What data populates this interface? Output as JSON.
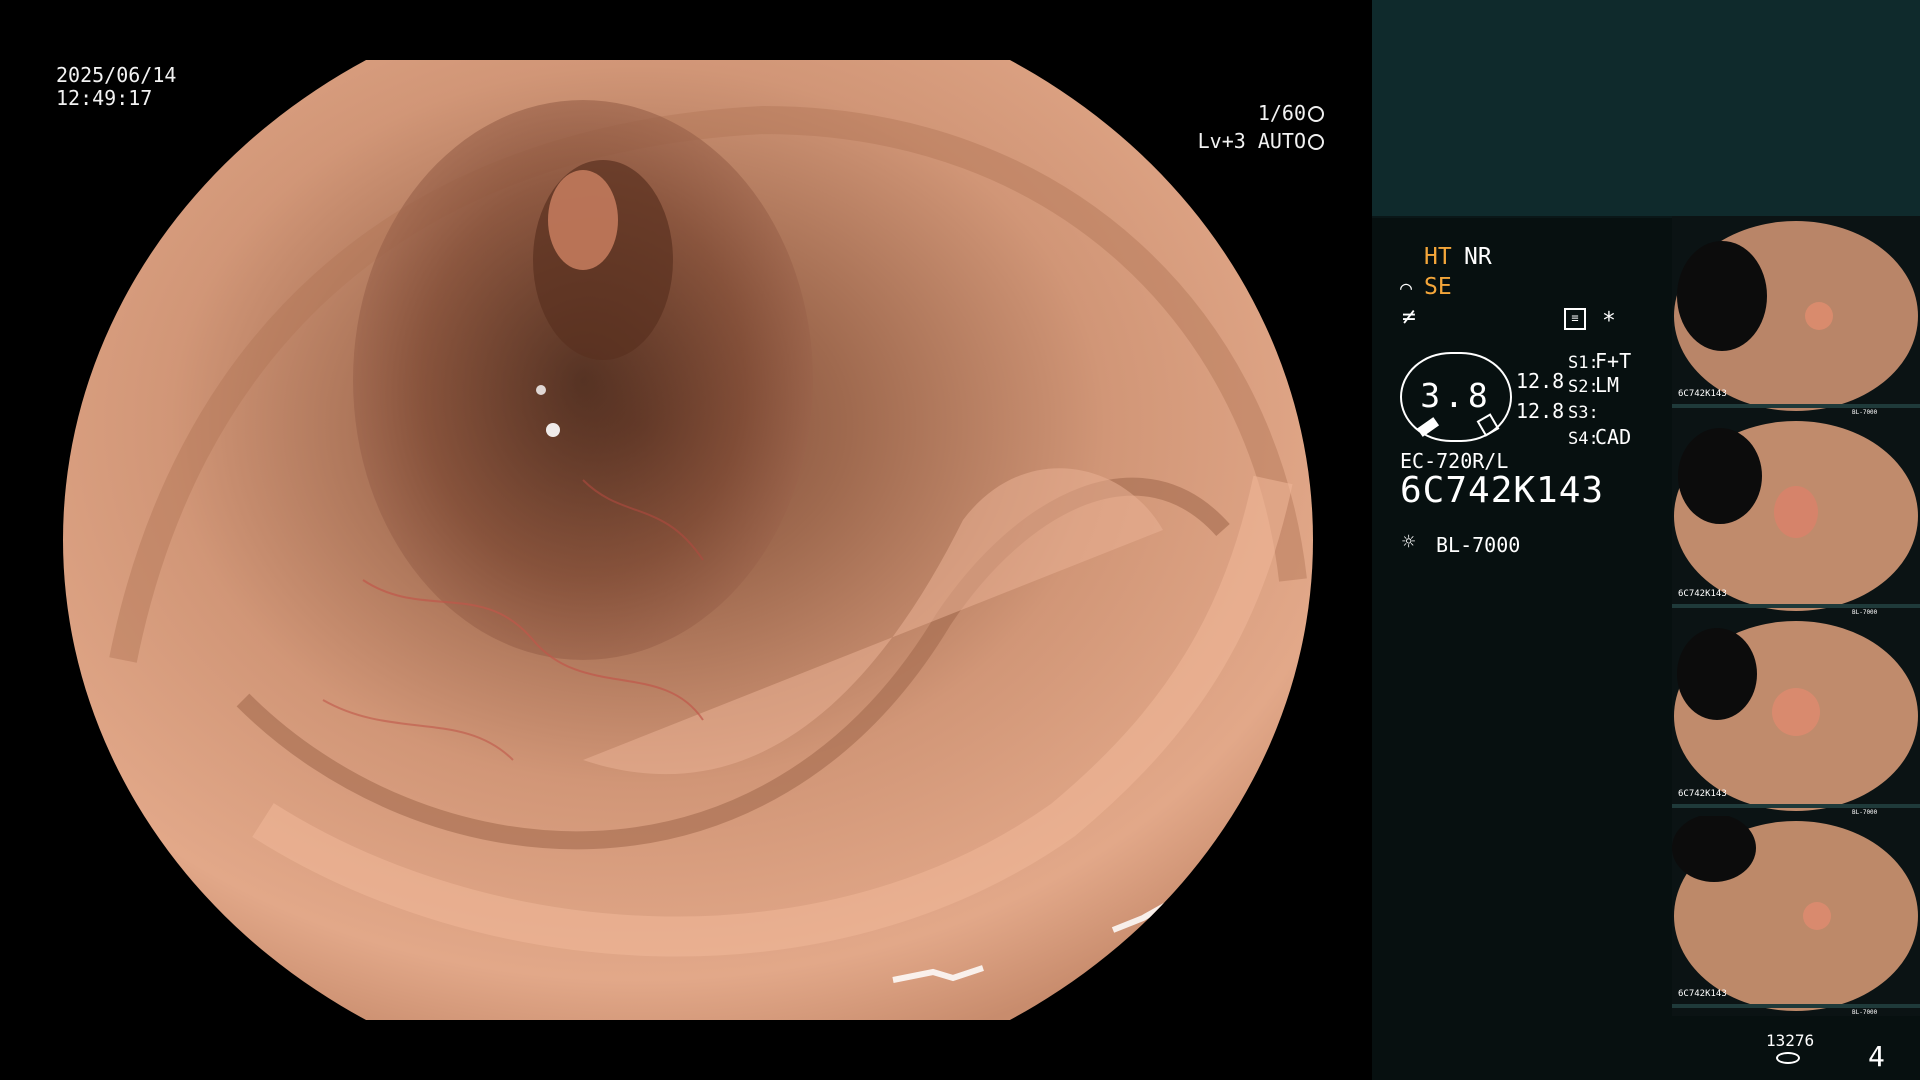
{
  "date": "2025/06/14",
  "time": "12:49:17",
  "shutter": "1/60",
  "level_auto": "Lv+3 AUTO",
  "panel": {
    "ht": "HT",
    "nr": "NR",
    "se": "SE",
    "dial_value": "3.8",
    "val1": "12.8",
    "val2": "12.8",
    "s1_label": "S1:",
    "s1_value": "F+T",
    "s2_label": "S2:",
    "s2_value": "LM",
    "s3_label": "S3:",
    "s3_value": "",
    "s4_label": "S4:",
    "s4_value": "CAD",
    "scope_model": "EC-720R/L",
    "serial": "6C742K143",
    "light_source": "BL-7000",
    "asterisk": "*"
  },
  "thumbnails": [
    {
      "label": "6C742K143",
      "source": "BL-7000"
    },
    {
      "label": "6C742K143",
      "source": "BL-7000"
    },
    {
      "label": "6C742K143",
      "source": "BL-7000"
    },
    {
      "label": "6C742K143",
      "source": "BL-7000"
    }
  ],
  "storage_count": "13276",
  "page_number": "4",
  "icons": [
    "shutter-icon",
    "auto-iris-icon",
    "scope-icon",
    "function-icon",
    "settings-icon",
    "light-source-icon",
    "storage-icon"
  ]
}
